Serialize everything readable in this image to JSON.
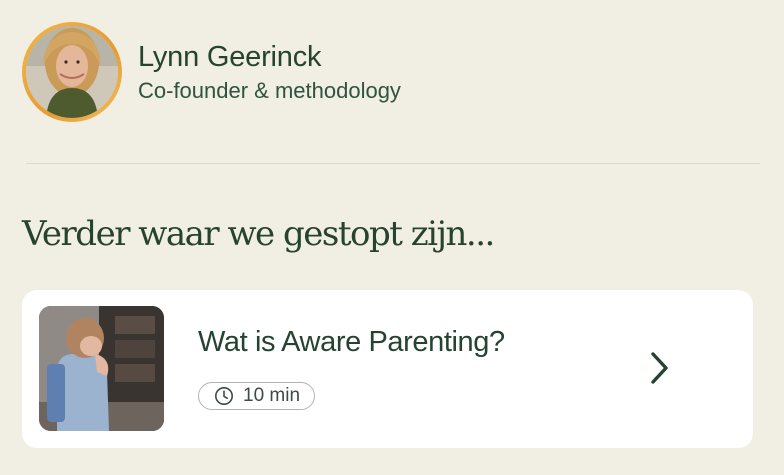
{
  "author": {
    "name": "Lynn Geerinck",
    "role": "Co-founder & methodology",
    "avatar_icon": "person-avatar"
  },
  "section": {
    "title": "Verder waar we gestopt zijn..."
  },
  "continue_card": {
    "title": "Wat is Aware Parenting?",
    "duration": "10 min",
    "thumbnail_icon": "child-with-backpack-photo",
    "open_icon": "chevron-right-icon"
  },
  "colors": {
    "background": "#f1eee3",
    "text_green": "#254330",
    "avatar_ring": "#e9a53a",
    "card": "#ffffff"
  }
}
